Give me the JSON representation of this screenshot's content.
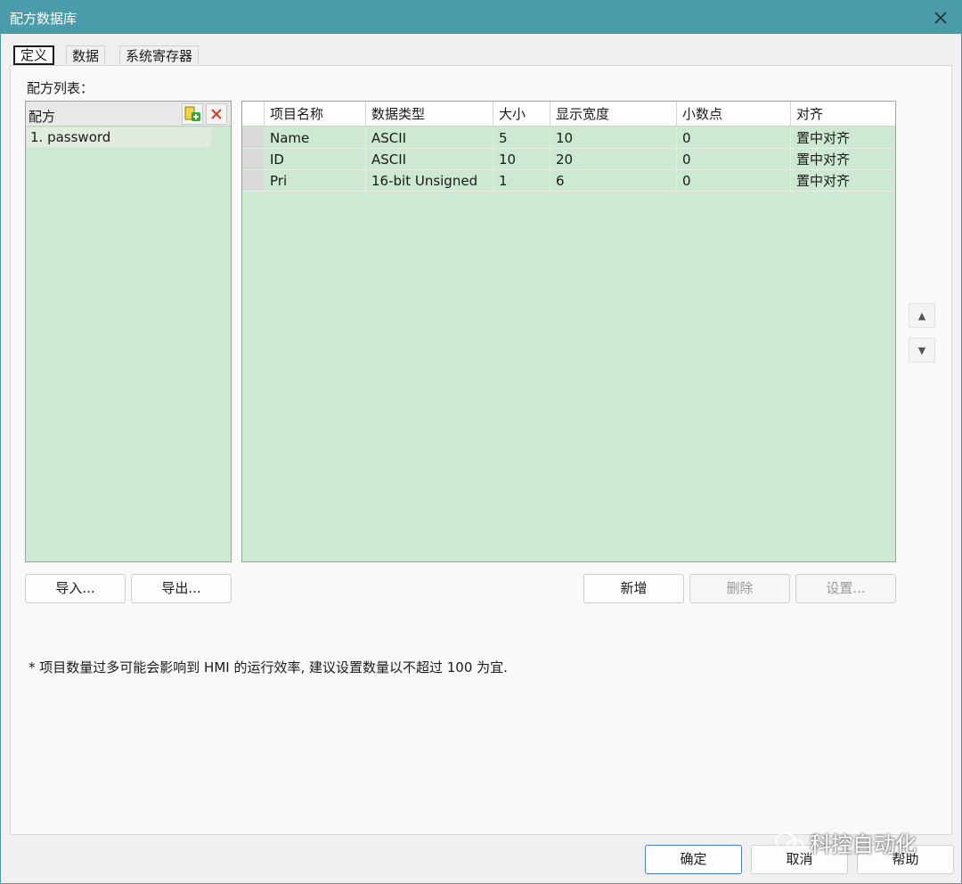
{
  "window": {
    "title": "配方数据库"
  },
  "tabs": [
    {
      "label": "定义",
      "active": true
    },
    {
      "label": "数据",
      "active": false
    },
    {
      "label": "系统寄存器",
      "active": false
    }
  ],
  "recipe_list_label": "配方列表：",
  "recipe_panel": {
    "header": "配方",
    "items": [
      "1. password"
    ]
  },
  "table": {
    "columns": [
      "项目名称",
      "数据类型",
      "大小",
      "显示宽度",
      "小数点",
      "对齐"
    ],
    "rows": [
      [
        "Name",
        "ASCII",
        "5",
        "10",
        "0",
        "置中对齐"
      ],
      [
        "ID",
        "ASCII",
        "10",
        "20",
        "0",
        "置中对齐"
      ],
      [
        "Pri",
        "16-bit Unsigned",
        "1",
        "6",
        "0",
        "置中对齐"
      ]
    ]
  },
  "buttons": {
    "import": "导入...",
    "export": "导出...",
    "add": "新增",
    "delete": "删除",
    "settings": "设置...",
    "ok": "确定",
    "cancel": "取消",
    "help": "帮助"
  },
  "note": "* 项目数量过多可能会影响到 HMI 的运行效率, 建议设置数量以不超过 100 为宜.",
  "watermark": "科控自动化",
  "colors": {
    "titlebar": "#4a9cab",
    "grid_bg": "#cde9d1"
  }
}
